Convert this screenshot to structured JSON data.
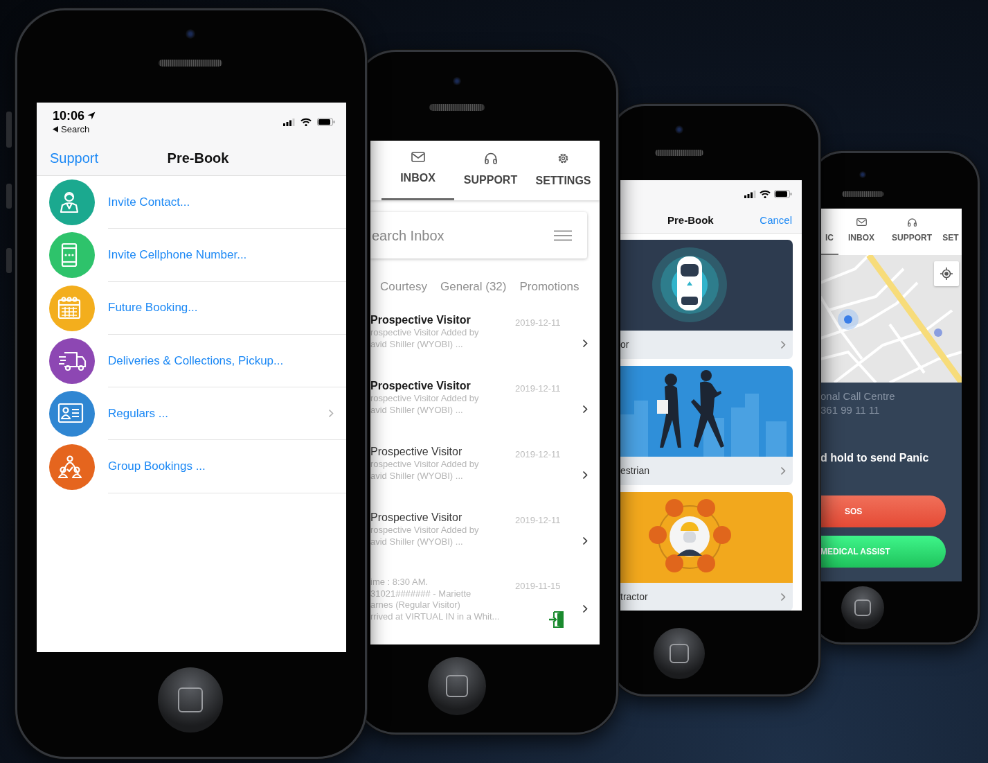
{
  "phones": [
    {
      "kind": "menu",
      "status_bar": {
        "time": "10:06",
        "back_label": "Search"
      },
      "nav": {
        "left": "Support",
        "title": "Pre-Book"
      },
      "items": [
        {
          "label": "Invite Contact...",
          "kind": "contact",
          "color": "#1ba98f",
          "chevron": false
        },
        {
          "label": "Invite Cellphone Number...",
          "kind": "cellphone",
          "color": "#2ec36b",
          "chevron": false
        },
        {
          "label": "Future Booking...",
          "kind": "calendar",
          "color": "#f3ae1d",
          "chevron": false
        },
        {
          "label": "Deliveries & Collections, Pickup...",
          "kind": "delivery",
          "color": "#8d47b3",
          "chevron": false
        },
        {
          "label": "Regulars ...",
          "kind": "regulars",
          "color": "#2f86d2",
          "chevron": true
        },
        {
          "label": "Group Bookings ...",
          "kind": "group",
          "color": "#e5651e",
          "chevron": false
        }
      ]
    },
    {
      "kind": "inbox",
      "tabs": [
        {
          "label": "INBOX",
          "kind": "mail",
          "selected": true
        },
        {
          "label": "SUPPORT",
          "kind": "headset",
          "selected": false
        },
        {
          "label": "SETTINGS",
          "kind": "gear",
          "selected": false
        }
      ],
      "search": {
        "placeholder": "earch Inbox"
      },
      "filters": [
        "Courtesy",
        "General (32)",
        "Promotions"
      ],
      "messages": [
        {
          "title": "Prospective Visitor",
          "unread": true,
          "lines": [
            "rospective Visitor Added by",
            "avid Shiller (WYOBI) ..."
          ],
          "date": "2019-12-11",
          "arrived": false
        },
        {
          "title": "Prospective Visitor",
          "unread": true,
          "lines": [
            "rospective Visitor Added by",
            "avid Shiller (WYOBI) ..."
          ],
          "date": "2019-12-11",
          "arrived": false
        },
        {
          "title": "Prospective Visitor",
          "unread": false,
          "lines": [
            "rospective Visitor Added by",
            "avid Shiller (WYOBI) ..."
          ],
          "date": "2019-12-11",
          "arrived": false
        },
        {
          "title": "Prospective Visitor",
          "unread": false,
          "lines": [
            "rospective Visitor Added by",
            "avid Shiller (WYOBI) ..."
          ],
          "date": "2019-12-11",
          "arrived": false
        },
        {
          "lines": [
            "ime : 8:30 AM.",
            "31021####### - Mariette",
            "arnes  (Regular Visitor)",
            "rrived  at VIRTUAL IN in a Whit..."
          ],
          "date": "2019-11-15",
          "arrived": true
        }
      ]
    },
    {
      "kind": "cards",
      "nav": {
        "title": "Pre-Book",
        "right": "Cancel"
      },
      "cards": [
        {
          "label": "or",
          "kind": "car",
          "color": "#2d3b4f"
        },
        {
          "label": "estrian",
          "kind": "pedestrian",
          "color": "#2f8fd9"
        },
        {
          "label": "tractor",
          "kind": "contractor",
          "color": "#f2a81d"
        }
      ]
    },
    {
      "kind": "panic",
      "tabs": [
        {
          "label": "IC",
          "kind": "plain",
          "selected": true
        },
        {
          "label": "INBOX",
          "kind": "mail",
          "selected": false
        },
        {
          "label": "SUPPORT",
          "kind": "headset",
          "selected": false
        },
        {
          "label": "SET",
          "kind": "plain",
          "selected": false
        }
      ],
      "info_lines": [
        "onal Call Centre",
        "361 99 11 11"
      ],
      "prompt": "d hold to send Panic",
      "buttons": [
        {
          "label": "SOS",
          "kind": "sos"
        },
        {
          "label": "MEDICAL ASSIST",
          "kind": "medical"
        }
      ]
    }
  ]
}
